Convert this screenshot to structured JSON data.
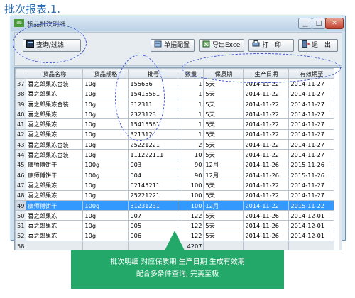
{
  "page_title": "批次报表.1.",
  "window": {
    "title": "货品批次明细",
    "app_icon": "app-icon",
    "min_label": "▁",
    "max_label": "□",
    "close_label": "✕"
  },
  "toolbar": {
    "query_label": "查询/过滤",
    "config_label": "单据配置",
    "excel_label": "导出Excel",
    "print_label": "打　印",
    "exit_label": "退　出"
  },
  "table": {
    "columns": [
      "",
      "货品名称",
      "货品规格",
      "批号",
      "数量",
      "保质期",
      "生产日期",
      "有效期至"
    ],
    "rows": [
      [
        "37",
        "喜之郎果冻金装",
        "10g",
        "155656",
        "1",
        "5天",
        "2014-11-22",
        "2014-11-27"
      ],
      [
        "38",
        "喜之郎果冻",
        "10g",
        "15415561",
        "1",
        "5天",
        "2014-11-22",
        "2014-11-27"
      ],
      [
        "39",
        "喜之郎果冻金装",
        "10g",
        "312311",
        "1",
        "5天",
        "2014-11-22",
        "2014-11-27"
      ],
      [
        "40",
        "喜之郎果冻",
        "10g",
        "2323123",
        "1",
        "5天",
        "2014-11-22",
        "2014-11-27"
      ],
      [
        "41",
        "喜之郎果冻",
        "10g",
        "15415561",
        "1",
        "5天",
        "2014-11-22",
        "2014-11-27"
      ],
      [
        "42",
        "喜之郎果冻",
        "10g",
        "321312",
        "1",
        "5天",
        "2014-11-22",
        "2014-11-27"
      ],
      [
        "43",
        "喜之郎果冻金装",
        "10g",
        "25221221",
        "2",
        "5天",
        "2014-11-22",
        "2014-11-27"
      ],
      [
        "44",
        "喜之郎果冻金装",
        "10g",
        "111222111",
        "10",
        "5天",
        "2014-11-22",
        "2014-11-27"
      ],
      [
        "45",
        "康师傅饼干",
        "100g",
        "003",
        "90",
        "12月",
        "2014-11-26",
        "2015-11-26"
      ],
      [
        "46",
        "康师傅饼干",
        "100g",
        "004",
        "90",
        "12月",
        "2014-11-26",
        "2015-11-26"
      ],
      [
        "47",
        "喜之郎果冻",
        "10g",
        "02145211",
        "100",
        "5天",
        "2014-11-22",
        "2014-11-27"
      ],
      [
        "48",
        "喜之郎果冻",
        "10g",
        "25221221",
        "100",
        "5天",
        "2014-11-22",
        "2014-11-27"
      ],
      [
        "49",
        "康师傅饼干",
        "100g",
        "31231231",
        "100",
        "12月",
        "2014-11-22",
        "2015-11-22"
      ],
      [
        "50",
        "喜之郎果冻",
        "10g",
        "007",
        "122",
        "5天",
        "2014-11-26",
        "2014-12-01"
      ],
      [
        "51",
        "喜之郎果冻",
        "10g",
        "005",
        "122",
        "5天",
        "2014-11-26",
        "2014-12-01"
      ],
      [
        "52",
        "喜之郎果冻",
        "10g",
        "006",
        "122",
        "5天",
        "2014-11-26",
        "2014-12-01"
      ]
    ],
    "selected_row_index": 12,
    "total_row": [
      "58",
      "",
      "",
      "",
      "4207",
      "",
      "",
      ""
    ]
  },
  "annotation": {
    "line1": "批次明细  对应保质期  生产日期  生成有效期",
    "line2": "配合多条件查询, 完美至极"
  },
  "colors": {
    "accent": "#2a6db5",
    "selected_row": "#3399ff",
    "annotation_bg": "#23a86a",
    "ellipse": "#3b55d6"
  },
  "icons": [
    "query-icon",
    "config-icon",
    "excel-icon",
    "print-icon",
    "exit-icon"
  ]
}
